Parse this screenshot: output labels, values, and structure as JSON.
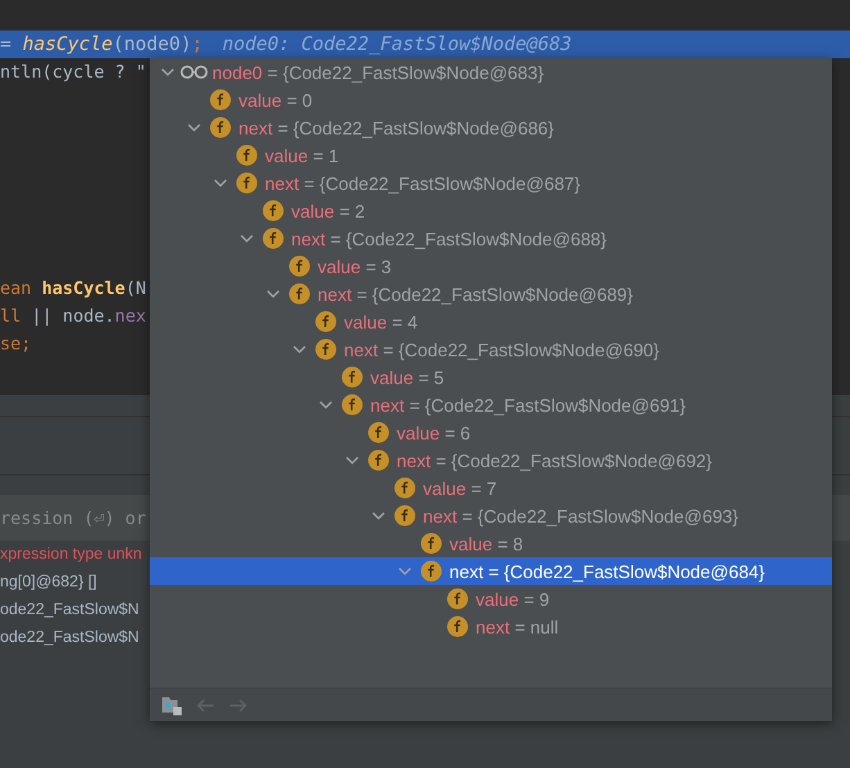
{
  "editor": {
    "current_line": {
      "segments": [
        {
          "text": "= ",
          "kind": "plain"
        },
        {
          "text": "hasCycle",
          "kind": "call"
        },
        {
          "text": "(node0)",
          "kind": "plain"
        },
        {
          "text": ";",
          "kind": "punct"
        }
      ],
      "hint": "node0: Code22_FastSlow$Node@683"
    },
    "top_lines": [
      {
        "segments": [
          {
            "text": "ntln(cycle ? \"",
            "kind": "plain"
          }
        ]
      }
    ],
    "method_lines": [
      {
        "segments": [
          {
            "text": "ean ",
            "kind": "keyword"
          },
          {
            "text": "hasCycle",
            "kind": "method"
          },
          {
            "text": "(N",
            "kind": "plain"
          }
        ]
      },
      {
        "segments": [
          {
            "text": "ll",
            "kind": "keyword"
          },
          {
            "text": " || node.",
            "kind": "plain"
          },
          {
            "text": "nex",
            "kind": "field"
          }
        ]
      },
      {
        "segments": [
          {
            "text": "se;",
            "kind": "keyword"
          }
        ]
      }
    ]
  },
  "evaluate": {
    "placeholder": "ression (⏎) or"
  },
  "results": [
    {
      "text": "xpression type unkn",
      "kind": "error"
    },
    {
      "text": "ng[0]@682} []",
      "kind": "value"
    },
    {
      "text": "ode22_FastSlow$N",
      "kind": "value"
    },
    {
      "text": "ode22_FastSlow$N",
      "kind": "value"
    }
  ],
  "popup": {
    "tree": [
      {
        "name": "node0",
        "value": "= {Code22_FastSlow$Node@683}",
        "kind": "watch",
        "expanded": true,
        "selected": false,
        "children": [
          {
            "name": "value",
            "value": "= 0",
            "kind": "field",
            "selected": false
          },
          {
            "name": "next",
            "value": "= {Code22_FastSlow$Node@686}",
            "kind": "field",
            "expanded": true,
            "selected": false,
            "children": [
              {
                "name": "value",
                "value": "= 1",
                "kind": "field",
                "selected": false
              },
              {
                "name": "next",
                "value": "= {Code22_FastSlow$Node@687}",
                "kind": "field",
                "expanded": true,
                "selected": false,
                "children": [
                  {
                    "name": "value",
                    "value": "= 2",
                    "kind": "field",
                    "selected": false
                  },
                  {
                    "name": "next",
                    "value": "= {Code22_FastSlow$Node@688}",
                    "kind": "field",
                    "expanded": true,
                    "selected": false,
                    "children": [
                      {
                        "name": "value",
                        "value": "= 3",
                        "kind": "field",
                        "selected": false
                      },
                      {
                        "name": "next",
                        "value": "= {Code22_FastSlow$Node@689}",
                        "kind": "field",
                        "expanded": true,
                        "selected": false,
                        "children": [
                          {
                            "name": "value",
                            "value": "= 4",
                            "kind": "field",
                            "selected": false
                          },
                          {
                            "name": "next",
                            "value": "= {Code22_FastSlow$Node@690}",
                            "kind": "field",
                            "expanded": true,
                            "selected": false,
                            "children": [
                              {
                                "name": "value",
                                "value": "= 5",
                                "kind": "field",
                                "selected": false
                              },
                              {
                                "name": "next",
                                "value": "= {Code22_FastSlow$Node@691}",
                                "kind": "field",
                                "expanded": true,
                                "selected": false,
                                "children": [
                                  {
                                    "name": "value",
                                    "value": "= 6",
                                    "kind": "field",
                                    "selected": false
                                  },
                                  {
                                    "name": "next",
                                    "value": "= {Code22_FastSlow$Node@692}",
                                    "kind": "field",
                                    "expanded": true,
                                    "selected": false,
                                    "children": [
                                      {
                                        "name": "value",
                                        "value": "= 7",
                                        "kind": "field",
                                        "selected": false
                                      },
                                      {
                                        "name": "next",
                                        "value": "= {Code22_FastSlow$Node@693}",
                                        "kind": "field",
                                        "expanded": true,
                                        "selected": false,
                                        "children": [
                                          {
                                            "name": "value",
                                            "value": "= 8",
                                            "kind": "field",
                                            "selected": false
                                          },
                                          {
                                            "name": "next",
                                            "value": "= {Code22_FastSlow$Node@684}",
                                            "kind": "field",
                                            "expanded": true,
                                            "selected": true,
                                            "children": [
                                              {
                                                "name": "value",
                                                "value": "= 9",
                                                "kind": "field",
                                                "selected": false
                                              },
                                              {
                                                "name": "next",
                                                "value": "= null",
                                                "kind": "field",
                                                "selected": false
                                              }
                                            ]
                                          }
                                        ]
                                      }
                                    ]
                                  }
                                ]
                              }
                            ]
                          }
                        ]
                      }
                    ]
                  }
                ]
              }
            ]
          }
        ]
      }
    ],
    "toolbar": [
      {
        "kind": "folder",
        "disabled": false
      },
      {
        "kind": "back",
        "disabled": true
      },
      {
        "kind": "forward",
        "disabled": true
      }
    ]
  }
}
